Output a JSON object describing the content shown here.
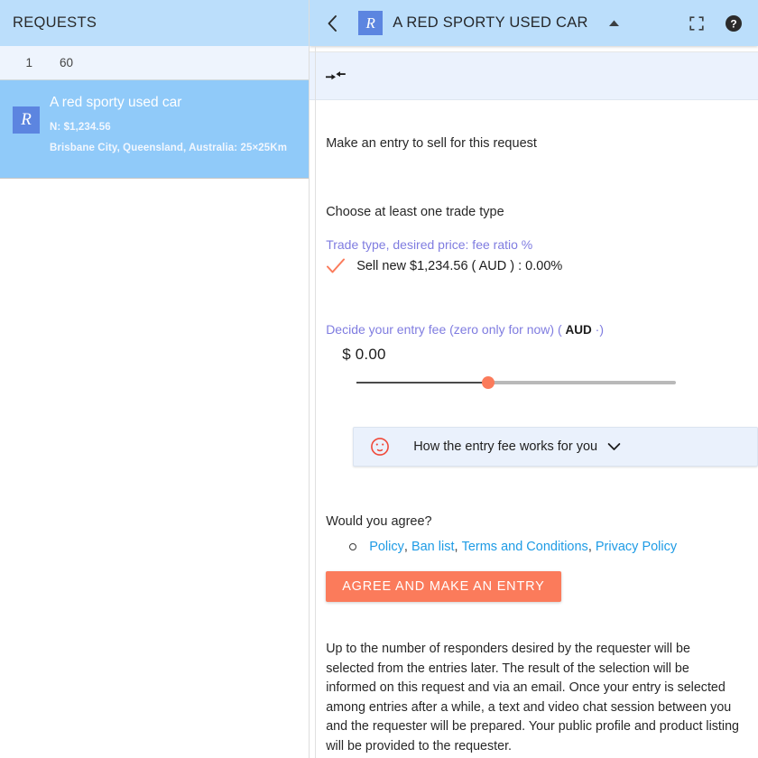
{
  "sidebar": {
    "header_title": "REQUESTS",
    "subbar": {
      "page_number": "1",
      "count": "60"
    },
    "request_card": {
      "badge": "R",
      "title": "A red sporty used car",
      "price_line": "N: $1,234.56",
      "location_line": "Brisbane City, Queensland, Australia: 25×25Km"
    }
  },
  "detail_header": {
    "back_icon": "chevron-left-icon",
    "badge": "R",
    "title": "A RED SPORTY USED CAR",
    "caret_icon": "caret-up-icon",
    "fullscreen_icon": "fullscreen-icon",
    "help_icon": "help-circle-icon"
  },
  "toolbar": {
    "collapse_icon": "collapse-arrows-icon"
  },
  "content": {
    "intro": "Make an entry to sell for this request",
    "choose_trade_type": "Choose at least one trade type",
    "trade_type_label": "Trade type, desired price: fee ratio %",
    "trade_option": {
      "check_icon": "check-icon",
      "text": "Sell new $1,234.56 (  AUD  ) : 0.00%"
    },
    "fee_label": "Decide your entry fee (zero only for now) ( ",
    "fee_currency": "AUD",
    "fee_label_tail": " ·)",
    "fee_amount": "$ 0.00",
    "slider": {
      "value": "0.00",
      "thumb_position_pct": "40"
    },
    "info_box": {
      "face_icon": "smiley-face-icon",
      "text": "How the entry fee works for you",
      "chevron_icon": "chevron-down-icon"
    },
    "agree_question": "Would you agree?",
    "links": [
      {
        "label": "Policy"
      },
      {
        "label": "Ban list"
      },
      {
        "label": "Terms and Conditions"
      },
      {
        "label": "Privacy Policy"
      }
    ],
    "agree_button": "AGREE AND MAKE AN ENTRY",
    "paragraph": "Up to the number of responders desired by the requester will be selected from the entries later. The result of the selection will be informed on this request and via an email. Once your entry is selected among entries after a while, a text and video chat session between you and the requester will be prepared. Your public profile and product listing will be provided to the requester."
  },
  "colors": {
    "header_blue": "#bbdefb",
    "selected_blue": "#90caf9",
    "badge_blue": "#5c85e0",
    "accent_orange": "#fb7b5b",
    "purple_label": "#7f7ce0",
    "link_blue": "#1e9be5"
  }
}
